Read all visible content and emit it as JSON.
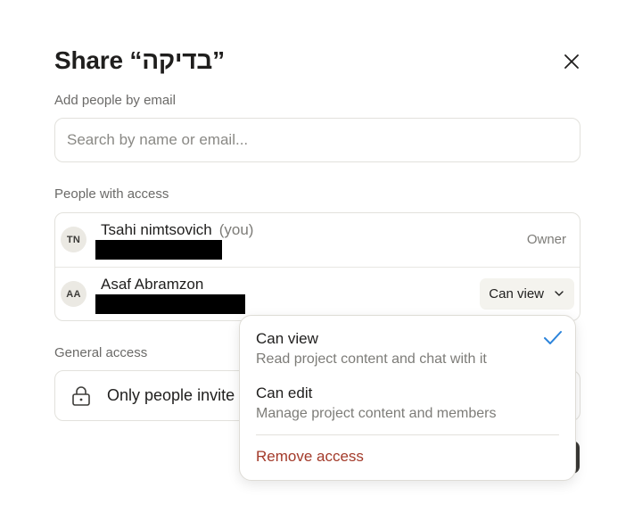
{
  "dialog": {
    "title": "Share “בדיקה”",
    "add_people_label": "Add people by email",
    "search_placeholder": "Search by name or email...",
    "people_label": "People with access",
    "general_access_label": "General access",
    "general_access_value": "Only people invite"
  },
  "people": [
    {
      "initials": "TN",
      "name": "Tsahi nimtsovich",
      "you_label": "(you)",
      "role": "Owner"
    },
    {
      "initials": "AA",
      "name": "Asaf Abramzon",
      "role": "Can view"
    }
  ],
  "role_menu": {
    "items": [
      {
        "title": "Can view",
        "description": "Read project content and chat with it",
        "selected": true
      },
      {
        "title": "Can edit",
        "description": "Manage project content and members",
        "selected": false
      }
    ],
    "remove_label": "Remove access"
  },
  "colors": {
    "accent": "#2c84db",
    "danger": "#a33a2a",
    "border": "#e2e1dc"
  }
}
